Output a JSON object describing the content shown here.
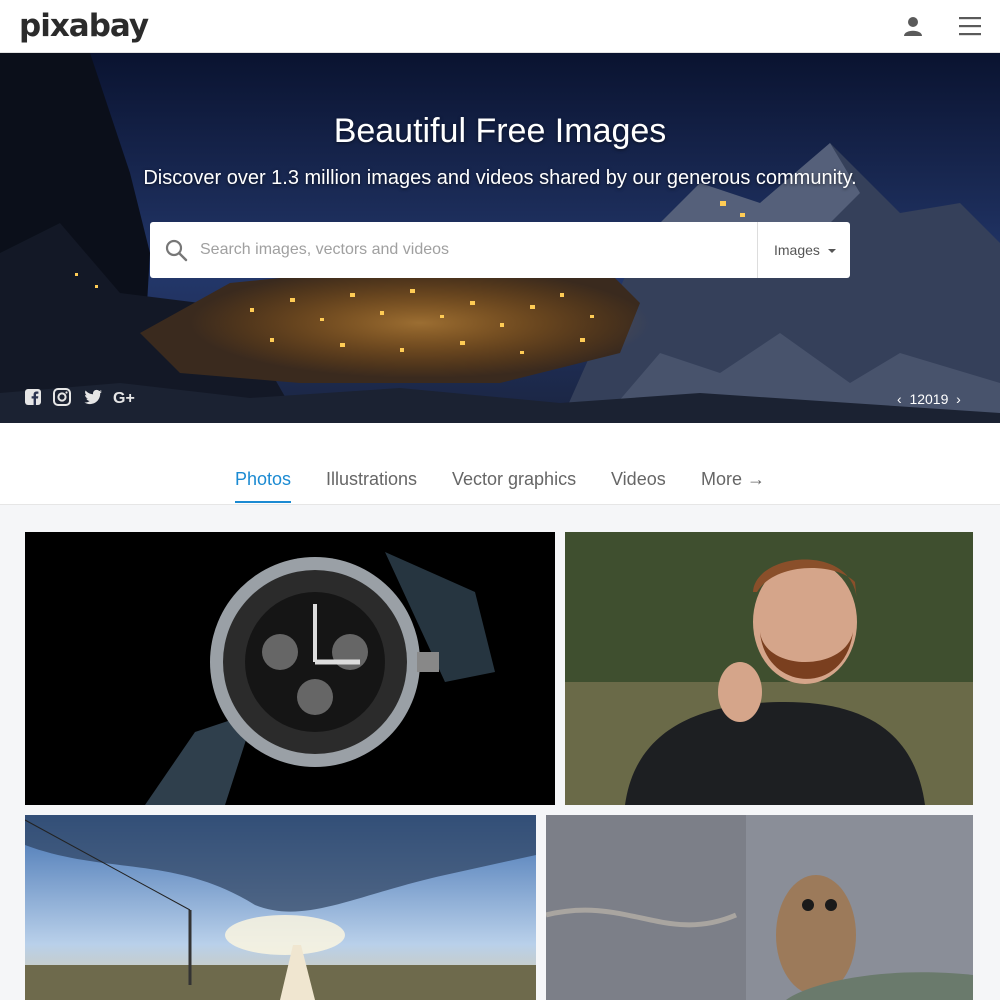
{
  "header": {
    "logo": "pixabay",
    "icons": {
      "user": "user-icon",
      "menu": "hamburger-menu-icon"
    }
  },
  "hero": {
    "title": "Beautiful Free Images",
    "subtitle": "Discover over 1.3 million images and videos shared by our generous community.",
    "search": {
      "placeholder": "Search images, vectors and videos",
      "value": "",
      "type_label": "Images"
    },
    "social_icons": [
      "facebook-icon",
      "instagram-icon",
      "twitter-icon",
      "google-plus-icon"
    ],
    "credit": {
      "prev": "‹",
      "label": "12019",
      "next": "›"
    }
  },
  "tabs": [
    {
      "label": "Photos",
      "active": true
    },
    {
      "label": "Illustrations",
      "active": false
    },
    {
      "label": "Vector graphics",
      "active": false
    },
    {
      "label": "Videos",
      "active": false
    },
    {
      "label": "More →",
      "active": false
    }
  ],
  "colors": {
    "accent": "#1b8ad2",
    "header_bg": "#ffffff",
    "page_bg": "#f5f6f8"
  }
}
